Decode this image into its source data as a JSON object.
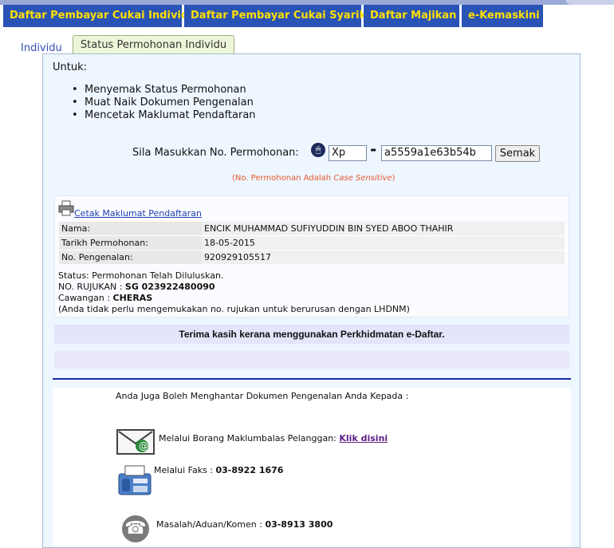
{
  "nav": {
    "tabs": [
      {
        "label": "Daftar Pembayar Cukai Individu"
      },
      {
        "label": "Daftar Pembayar Cukai Syarikat"
      },
      {
        "label": "Daftar Majikan"
      },
      {
        "label": "e-Kemaskini"
      }
    ]
  },
  "subtabs": {
    "individu": "Individu",
    "status": "Status Permohonan Individu"
  },
  "intro": {
    "title": "Untuk:",
    "items": [
      "Menyemak Status Permohonan",
      "Muat Naik Dokumen Pengenalan",
      "Mencetak Maklumat Pendaftaran"
    ]
  },
  "search": {
    "label": "Sila Masukkan No. Permohonan:",
    "prefix_value": "Xp",
    "separator": "-",
    "number_value": "a5559a1e63b54b",
    "button": "Semak",
    "note_prefix": "(No. Permohonan Adalah ",
    "note_italic": "Case Sensitive",
    "note_suffix": ")"
  },
  "result": {
    "print_link": "Cetak Maklumat Pendaftaran",
    "rows": [
      {
        "label": "Nama:",
        "value": "ENCIK MUHAMMAD SUFIYUDDIN BIN SYED ABOO THAHIR"
      },
      {
        "label": "Tarikh Permohonan:",
        "value": "18-05-2015"
      },
      {
        "label": "No. Pengenalan:",
        "value": "920929105517"
      }
    ],
    "status_line": "Status: Permohonan Telah Diluluskan.",
    "rujukan_label": "NO. RUJUKAN : ",
    "rujukan_value": "SG 023922480090",
    "cawangan_label": "Cawangan : ",
    "cawangan_value": "CHERAS",
    "note": "(Anda tidak perlu mengemukakan no. rujukan untuk berurusan dengan LHDNM)"
  },
  "thanks": "Terima kasih kerana menggunakan Perkhidmatan e-Daftar.",
  "contact": {
    "intro": "Anda Juga Boleh Menghantar Dokumen Pengenalan Anda Kepada :",
    "borang_label": "Melalui Borang Maklumbalas Pelanggan: ",
    "borang_link": "Klik disini",
    "faks_label": "Melalui Faks : ",
    "faks_value": "03-8922 1676",
    "masalah_label": "Masalah/Aduan/Komen : ",
    "masalah_value": "03-8913 3800"
  }
}
